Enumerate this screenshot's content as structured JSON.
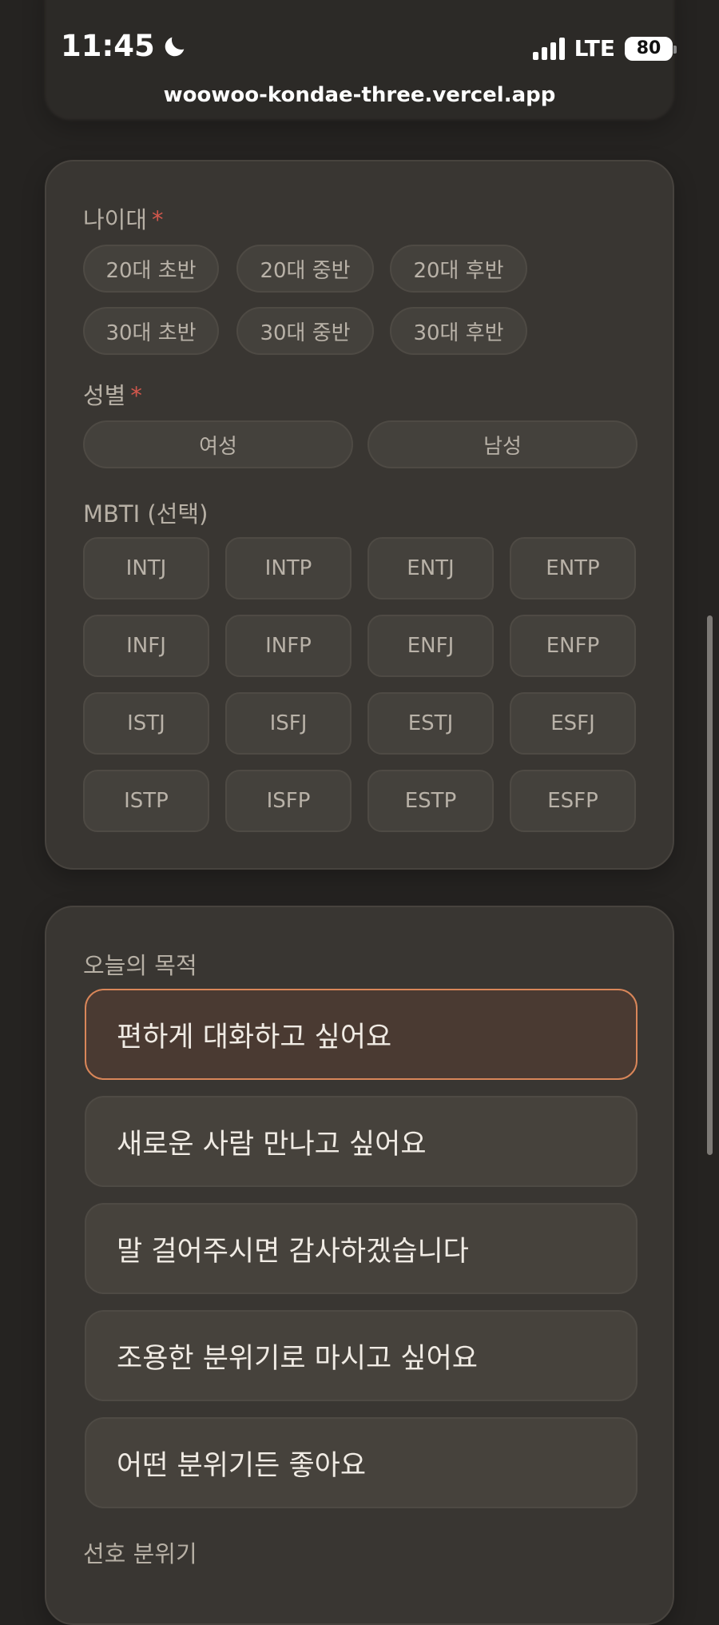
{
  "status_bar": {
    "time": "11:45",
    "network": "LTE",
    "battery": "80"
  },
  "browser": {
    "url": "woowoo-kondae-three.vercel.app"
  },
  "profile_card": {
    "age_label": "나이대",
    "required_mark": "*",
    "age_options": [
      "20대 초반",
      "20대 중반",
      "20대 후반",
      "30대 초반",
      "30대 중반",
      "30대 후반"
    ],
    "gender_label": "성별",
    "gender_options": [
      "여성",
      "남성"
    ],
    "mbti_label": "MBTI (선택)",
    "mbti_options": [
      "INTJ",
      "INTP",
      "ENTJ",
      "ENTP",
      "INFJ",
      "INFP",
      "ENFJ",
      "ENFP",
      "ISTJ",
      "ISFJ",
      "ESTJ",
      "ESFJ",
      "ISTP",
      "ISFP",
      "ESTP",
      "ESFP"
    ]
  },
  "purpose_card": {
    "title": "오늘의 목적",
    "options": [
      "편하게 대화하고 싶어요",
      "새로운 사람 만나고 싶어요",
      "말 걸어주시면 감사하겠습니다",
      "조용한 분위기로 마시고 싶어요",
      "어떤 분위기든 좋아요"
    ],
    "selected_index": 0,
    "next_section_label": "선호 분위기"
  },
  "colors": {
    "background": "#252321",
    "card": "#393632",
    "accent": "#d98659",
    "required": "#d2574c"
  }
}
